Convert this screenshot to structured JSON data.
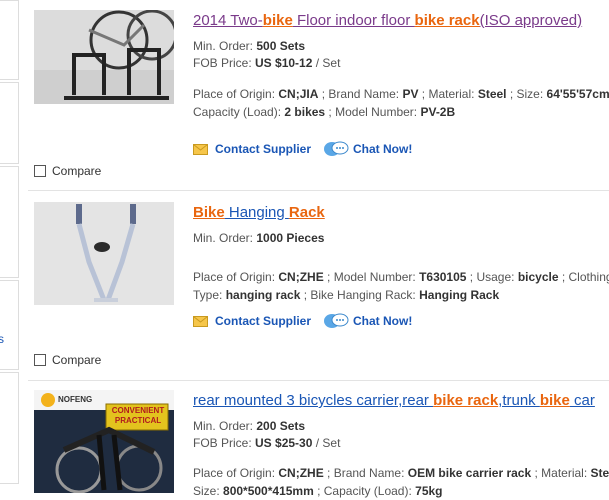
{
  "left_link": "s",
  "listings": [
    {
      "title_parts": [
        {
          "text": "2014 Two-",
          "hl": false
        },
        {
          "text": "bike",
          "hl": true
        },
        {
          "text": " Floor indoor floor ",
          "hl": false
        },
        {
          "text": "bike rack",
          "hl": true
        },
        {
          "text": "(ISO approved)",
          "hl": false
        }
      ],
      "title_color": "#7a3a8a",
      "min_order_label": "Min. Order: ",
      "min_order": "500 Sets",
      "fob_label": "FOB Price: ",
      "fob": "US $10-12",
      "fob_unit": " / Set",
      "attr_line1": [
        {
          "text": "Place of Origin: ",
          "b": false
        },
        {
          "text": "CN;JIA",
          "b": true
        },
        {
          "text": " ; Brand Name: ",
          "b": false
        },
        {
          "text": "PV",
          "b": true
        },
        {
          "text": " ; Material: ",
          "b": false
        },
        {
          "text": "Steel",
          "b": true
        },
        {
          "text": " ; Size: ",
          "b": false
        },
        {
          "text": "64'55'57cm",
          "b": true
        }
      ],
      "attr_line2": [
        {
          "text": "Capacity (Load): ",
          "b": false
        },
        {
          "text": "2 bikes",
          "b": true
        },
        {
          "text": " ; Model Number: ",
          "b": false
        },
        {
          "text": "PV-2B",
          "b": true
        }
      ],
      "contact_label": "Contact Supplier",
      "chat_label": "Chat Now!",
      "compare_label": "Compare"
    },
    {
      "title_parts": [
        {
          "text": "Bike",
          "hl": true
        },
        {
          "text": " Hanging ",
          "hl": false
        },
        {
          "text": "Rack",
          "hl": true
        }
      ],
      "title_color": "#1a56b5",
      "min_order_label": "Min. Order: ",
      "min_order": "1000 Pieces",
      "attr_line1": [
        {
          "text": "Place of Origin: ",
          "b": false
        },
        {
          "text": "CN;ZHE",
          "b": true
        },
        {
          "text": " ; Model Number: ",
          "b": false
        },
        {
          "text": "T630105",
          "b": true
        },
        {
          "text": " ; Usage: ",
          "b": false
        },
        {
          "text": "bicycle",
          "b": true
        },
        {
          "text": " ; Clothing",
          "b": false
        }
      ],
      "attr_line2": [
        {
          "text": "Type: ",
          "b": false
        },
        {
          "text": "hanging rack",
          "b": true
        },
        {
          "text": " ; Bike Hanging Rack: ",
          "b": false
        },
        {
          "text": "Hanging Rack",
          "b": true
        }
      ],
      "contact_label": "Contact Supplier",
      "chat_label": "Chat Now!",
      "compare_label": "Compare"
    },
    {
      "title_parts": [
        {
          "text": "rear mounted 3 bicycles carrier,rear ",
          "hl": false
        },
        {
          "text": "bike rack",
          "hl": true
        },
        {
          "text": ",trunk ",
          "hl": false
        },
        {
          "text": "bike",
          "hl": true
        },
        {
          "text": " car",
          "hl": false
        }
      ],
      "title_color": "#1a56b5",
      "min_order_label": "Min. Order: ",
      "min_order": "200 Sets",
      "fob_label": "FOB Price: ",
      "fob": "US $25-30",
      "fob_unit": " / Set",
      "attr_line1": [
        {
          "text": "Place of Origin: ",
          "b": false
        },
        {
          "text": "CN;ZHE",
          "b": true
        },
        {
          "text": " ; Brand Name: ",
          "b": false
        },
        {
          "text": "OEM bike carrier rack",
          "b": true
        },
        {
          "text": " ; Material: ",
          "b": false
        },
        {
          "text": "Steel",
          "b": true
        }
      ],
      "attr_line2": [
        {
          "text": "Size: ",
          "b": false
        },
        {
          "text": "800*500*415mm",
          "b": true
        },
        {
          "text": " ; Capacity (Load): ",
          "b": false
        },
        {
          "text": "75kg",
          "b": true
        }
      ],
      "badge_line1": "CONVENIENT",
      "badge_line2": "PRACTICAL",
      "badge_brand": "NOFENG"
    }
  ],
  "colors": {
    "highlight": "#e9660f",
    "link": "#1a56b5",
    "visited": "#7a3a8a"
  }
}
